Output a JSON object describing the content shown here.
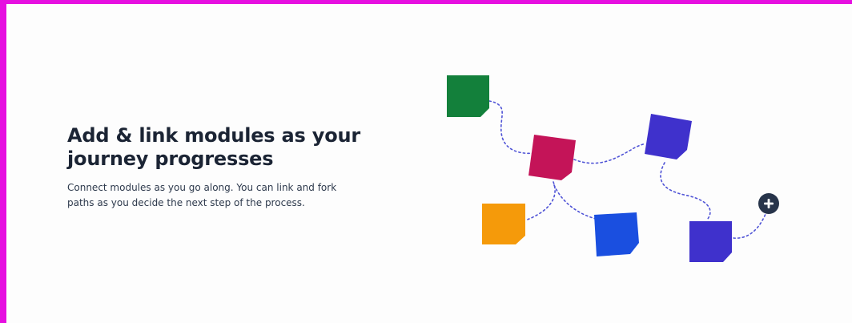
{
  "section": {
    "headline": "Add & link modules as your journey progresses",
    "description": "Connect modules as you go along. You can link and fork paths as you decide the next step of the process."
  },
  "illustration": {
    "modules": [
      {
        "name": "module-green",
        "color": "#13803b"
      },
      {
        "name": "module-magenta",
        "color": "#c41458"
      },
      {
        "name": "module-purple-top",
        "color": "#3f31cc"
      },
      {
        "name": "module-orange",
        "color": "#f59a0a"
      },
      {
        "name": "module-blue",
        "color": "#1a4fe0"
      },
      {
        "name": "module-purple-bottom",
        "color": "#3f31cc"
      }
    ],
    "connector_color": "#4f53d6",
    "add_button": {
      "icon": "plus-icon",
      "color": "#27344a"
    }
  },
  "colors": {
    "page_border": "#e60fe0",
    "background": "#fdfdfd",
    "heading_text": "#1b2434",
    "body_text": "#2e3a4d"
  }
}
